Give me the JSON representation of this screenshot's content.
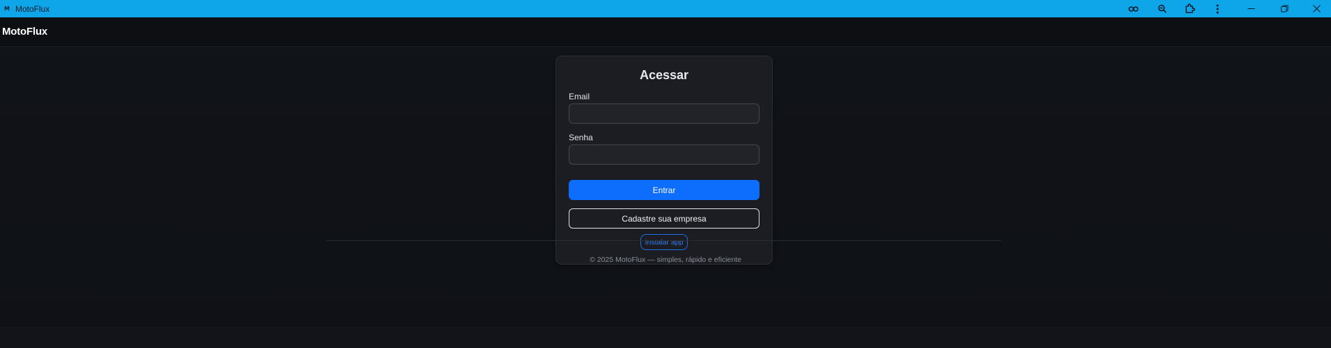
{
  "window": {
    "title": "MotoFlux",
    "icon_letter": "M",
    "accent_color": "#0ea5e9",
    "tools": [
      "key-icon",
      "zoom-out-icon",
      "extension-icon",
      "more-vertical-icon"
    ],
    "controls": [
      "minimize-icon",
      "restore-icon",
      "close-icon"
    ]
  },
  "header": {
    "brand": "MotoFlux"
  },
  "login": {
    "title": "Acessar",
    "email_label": "Email",
    "email_value": "",
    "password_label": "Senha",
    "password_value": "",
    "submit_label": "Entrar",
    "register_label": "Cadastre sua empresa",
    "install_label": "Instalar app",
    "primary_color": "#0d6efd"
  },
  "footer": {
    "text": "© 2025 MotoFlux — simples, rápido e eficiente"
  }
}
